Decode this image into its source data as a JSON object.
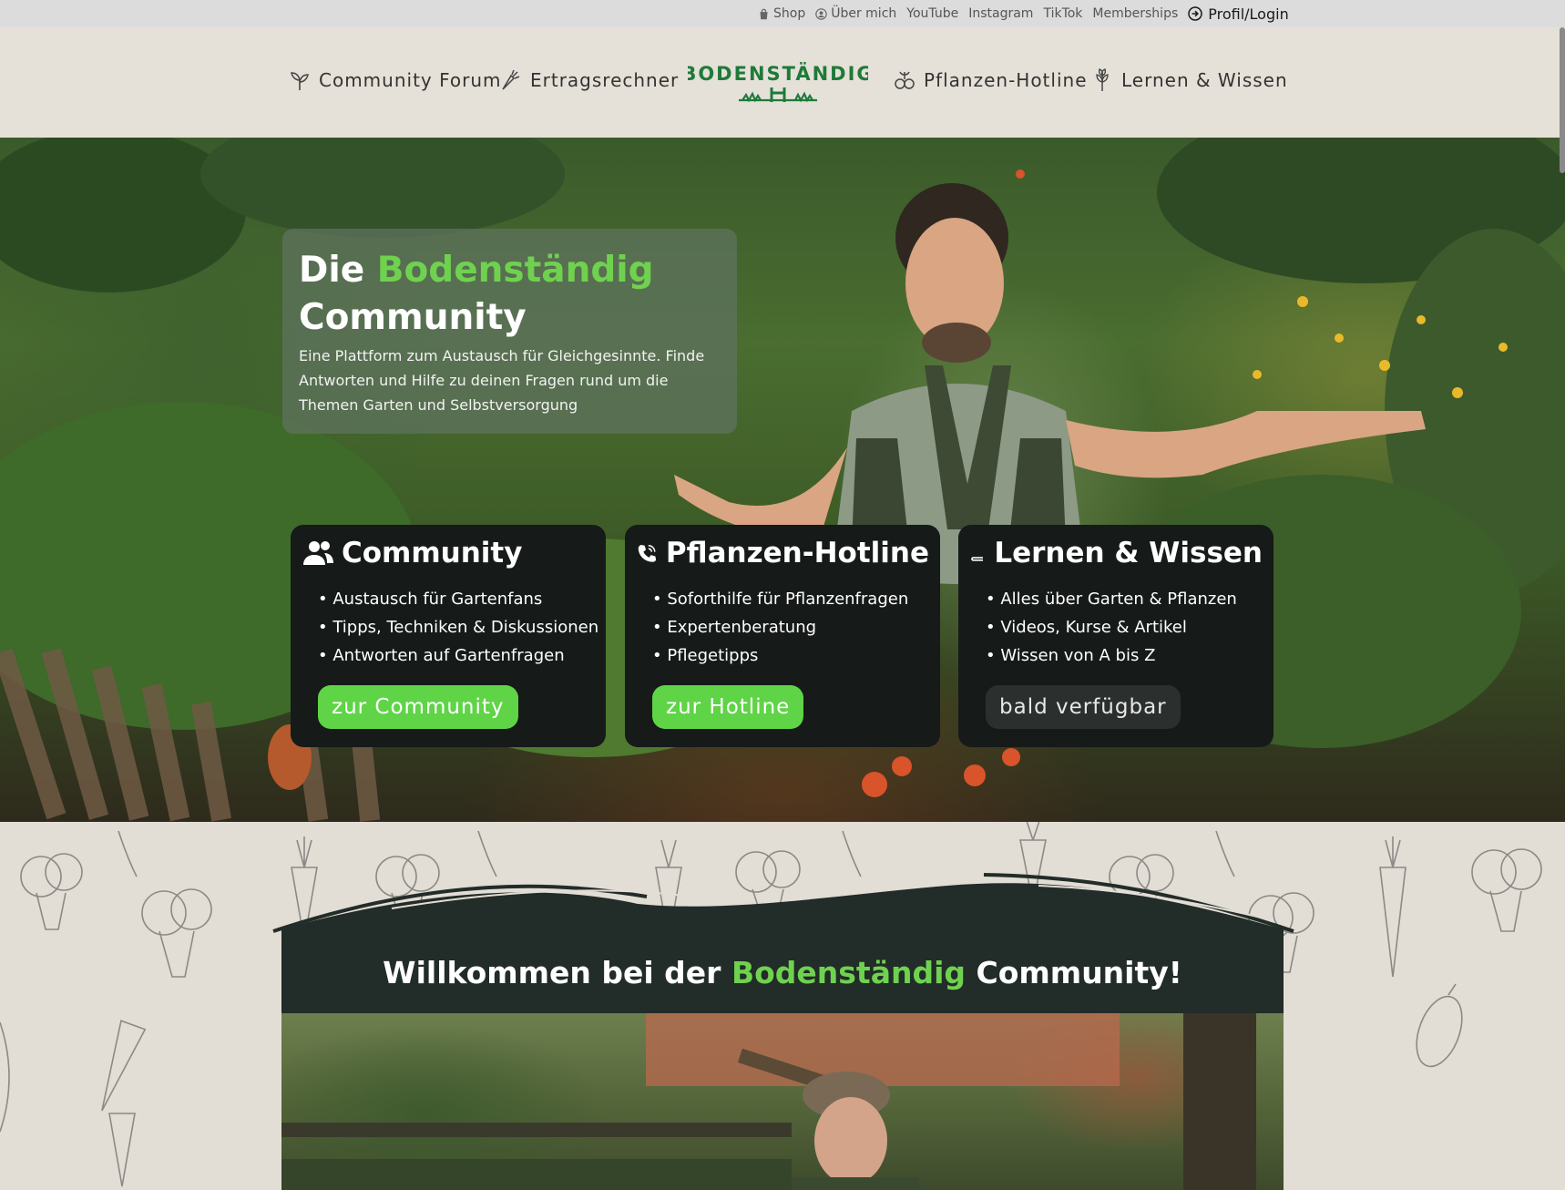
{
  "topbar": {
    "shop": "Shop",
    "about": "Über mich",
    "youtube": "YouTube",
    "instagram": "Instagram",
    "tiktok": "TikTok",
    "memberships": "Memberships",
    "login": "Profil/Login"
  },
  "nav": {
    "forum": "Community Forum",
    "calculator": "Ertragsrechner",
    "logo_text": "BODENSTÄNDIG",
    "hotline": "Pflanzen-Hotline",
    "learn": "Lernen & Wissen"
  },
  "hero": {
    "title_prefix": "Die",
    "title_accent": "Bodenständig",
    "title_suffix": "Community",
    "description": "Eine Plattform zum Austausch für Gleichgesinnte. Finde Antworten und Hilfe zu deinen Fragen rund um die Themen Garten und Selbstversorgung"
  },
  "cards": [
    {
      "title": "Community",
      "icon": "users-icon",
      "items": [
        "Austausch für Gartenfans",
        "Tipps, Techniken & Diskussionen",
        "Antworten auf Gartenfragen"
      ],
      "button": "zur Community"
    },
    {
      "title": "Pflanzen-Hotline",
      "icon": "phone-icon",
      "items": [
        "Soforthilfe für Pflanzenfragen",
        "Expertenberatung",
        "Pflegetipps"
      ],
      "button": "zur Hotline"
    },
    {
      "title": "Lernen & Wissen",
      "icon": "book-icon",
      "items": [
        "Alles über Garten & Pflanzen",
        "Videos, Kurse & Artikel",
        "Wissen von A bis Z"
      ],
      "button": "bald verfügbar"
    }
  ],
  "welcome": {
    "prefix": "Willkommen bei der",
    "accent": "Bodenständig",
    "suffix": "Community!"
  },
  "colors": {
    "accent_green": "#6fd24f",
    "button_green": "#5fd446",
    "card_bg": "#161a19",
    "welcome_bg": "#222c28",
    "logo_green": "#1f7a3a"
  }
}
